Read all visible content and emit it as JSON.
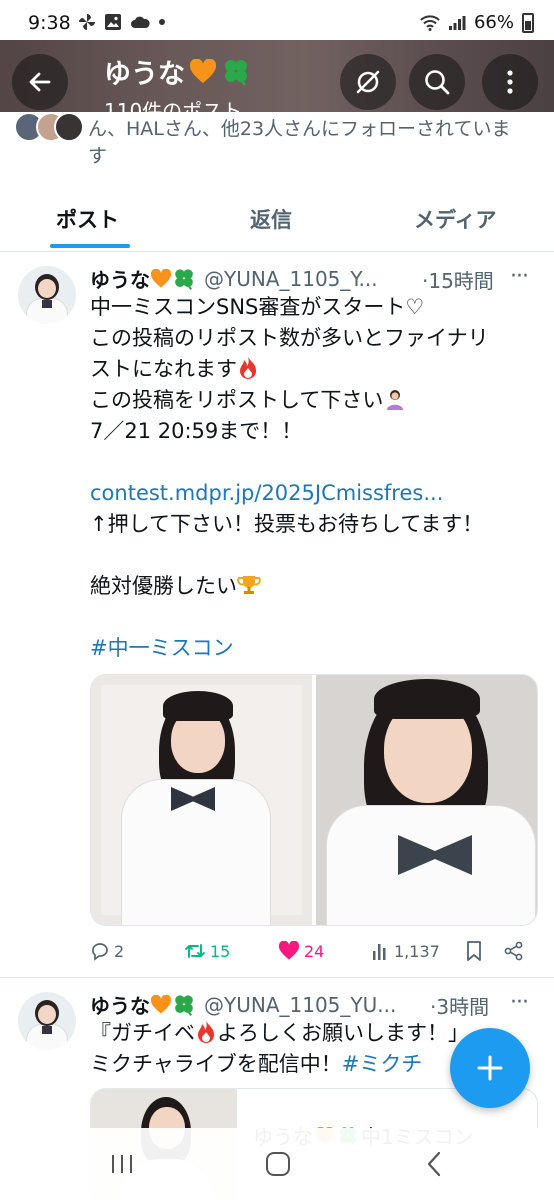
{
  "status_bar": {
    "time": "9:38",
    "battery": "66%"
  },
  "header": {
    "name": "ゆうな",
    "post_count": "110件のポスト"
  },
  "follow_note": "ん、HALさん、他23人さんにフォローされていま\nす",
  "tabs": [
    {
      "label": "ポスト",
      "active": true
    },
    {
      "label": "返信",
      "active": false
    },
    {
      "label": "メディア",
      "active": false
    }
  ],
  "tweets": [
    {
      "name": "ゆうな",
      "handle": "@YUNA_1105_Y...",
      "time": "·15時間",
      "more": "···",
      "lines": [
        "中一ミスコンSNS審査がスタート♡",
        "この投稿のリポスト数が多いとファイナリ",
        "ストになれます",
        "この投稿をリポストして下さい",
        "7／21 20:59まで！！"
      ],
      "link": "contest.mdpr.jp/2025JCmissfres...",
      "line_after_link": "↑押して下さい！投票もお待ちしてます！",
      "line_goal": "絶対優勝したい",
      "hashtag": "#中一ミスコン",
      "stats": {
        "replies": "2",
        "reposts": "15",
        "likes": "24",
        "views": "1,137"
      }
    },
    {
      "name": "ゆうな",
      "handle": "@YUNA_1105_YU...",
      "time": "·3時間",
      "more": "···",
      "line1": "『ガチイベ",
      "line1_rest": "よろしくお願いします！」",
      "line1_tail": "-",
      "line2": "ミクチャライブを配信中！",
      "line2_tag": "#ミクチ",
      "quote_text": "ゆうな",
      "quote_tail": "中1ミスコン"
    }
  ],
  "colors": {
    "accent": "#1d9bf0",
    "link": "#1d77b8",
    "repost": "#00ba7c",
    "like": "#f91880",
    "muted": "#536471"
  },
  "icons": {
    "back": "arrow-left-icon",
    "no_signal": "no-signal-icon",
    "search": "search-icon",
    "more": "more-vertical-icon",
    "reply": "reply-icon",
    "repost": "repost-icon",
    "like": "heart-icon",
    "views": "views-icon",
    "bookmark": "bookmark-icon",
    "share": "share-icon",
    "compose": "plus-icon"
  }
}
